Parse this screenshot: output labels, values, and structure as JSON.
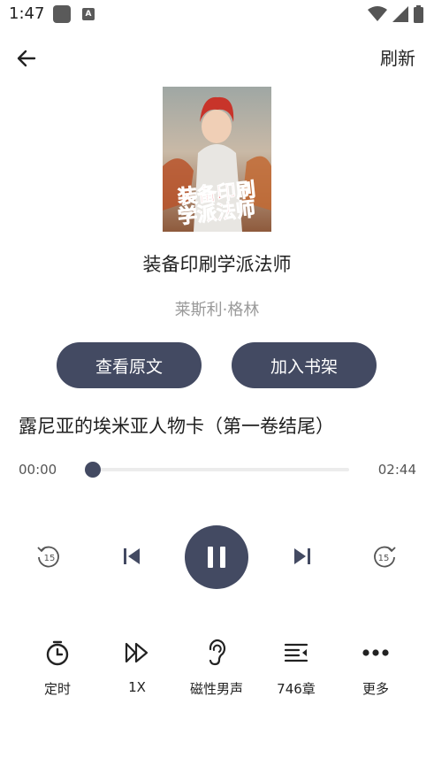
{
  "status_bar": {
    "time": "1:47",
    "badge_letter": "A"
  },
  "header": {
    "refresh_label": "刷新"
  },
  "book": {
    "title": "装备印刷学派法师",
    "author": "莱斯利·格林",
    "cover_text_line1": "装备印刷",
    "cover_text_line2": "学派法师"
  },
  "actions": {
    "view_original": "查看原文",
    "add_to_shelf": "加入书架"
  },
  "player": {
    "chapter_title": "露尼亚的埃米亚人物卡（第一卷结尾）",
    "current_time": "00:00",
    "total_time": "02:44",
    "progress": 0,
    "skip_seconds": "15"
  },
  "bottom_menu": {
    "timer": "定时",
    "speed": "1X",
    "voice": "磁性男声",
    "chapters": "746章",
    "more": "更多"
  },
  "colors": {
    "accent": "#434a62"
  }
}
